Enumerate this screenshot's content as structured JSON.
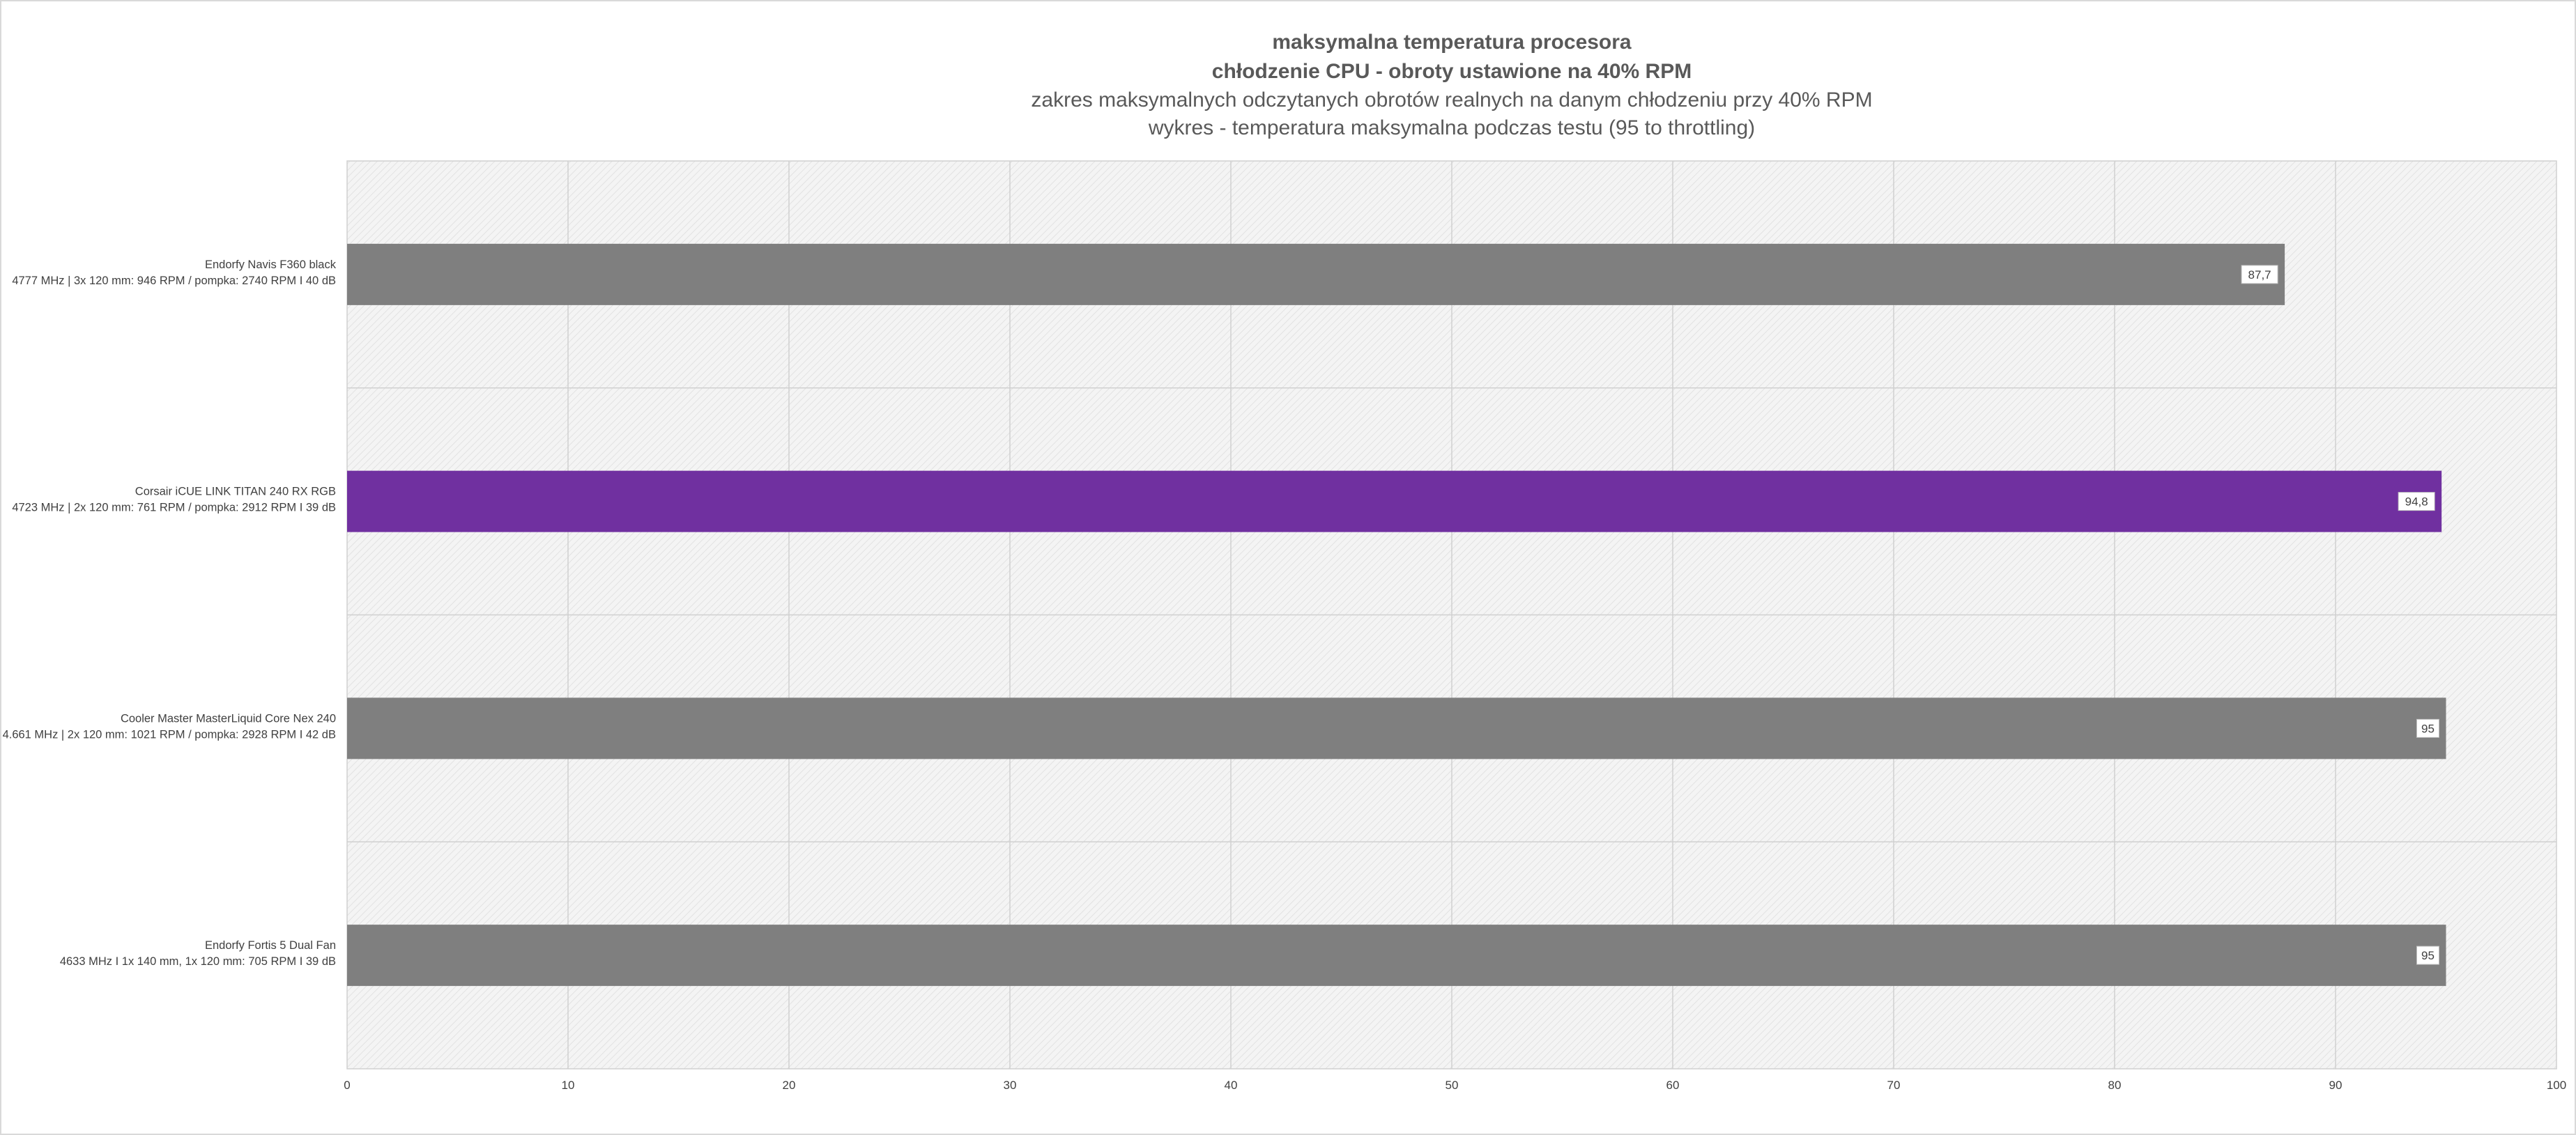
{
  "chart_data": {
    "type": "bar",
    "orientation": "horizontal",
    "title": [
      "maksymalna temperatura procesora",
      "chłodzenie CPU - obroty ustawione na 40% RPM",
      "zakres maksymalnych odczytanych obrotów realnych na danym chłodzeniu przy 40% RPM",
      "wykres - temperatura maksymalna podczas testu (95 to throttling)"
    ],
    "categories": [
      [
        "Endorfy Navis F360 black",
        "4777 MHz  |  3x 120 mm: 946 RPM / pompka: 2740 RPM I 40 dB"
      ],
      [
        "Corsair iCUE LINK TITAN 240 RX RGB",
        "4723 MHz  |  2x 120 mm: 761 RPM / pompka: 2912 RPM I 39 dB"
      ],
      [
        "Cooler Master MasterLiquid Core Nex 240",
        "4.661 MHz  |  2x 120 mm: 1021 RPM / pompka: 2928 RPM I 42 dB"
      ],
      [
        "Endorfy Fortis 5 Dual Fan",
        "4633 MHz I 1x 140 mm, 1x 120 mm: 705 RPM I 39 dB"
      ]
    ],
    "values": [
      87.7,
      94.8,
      95,
      95
    ],
    "value_labels": [
      "87,7",
      "94,8",
      "95",
      "95"
    ],
    "bar_colors": [
      "#7f7f7f",
      "#7030a0",
      "#7f7f7f",
      "#7f7f7f"
    ],
    "xlim": [
      0,
      100
    ],
    "xticks": [
      "0",
      "10",
      "20",
      "30",
      "40",
      "50",
      "60",
      "70",
      "80",
      "90",
      "100"
    ],
    "grid": true,
    "legend": "none"
  }
}
